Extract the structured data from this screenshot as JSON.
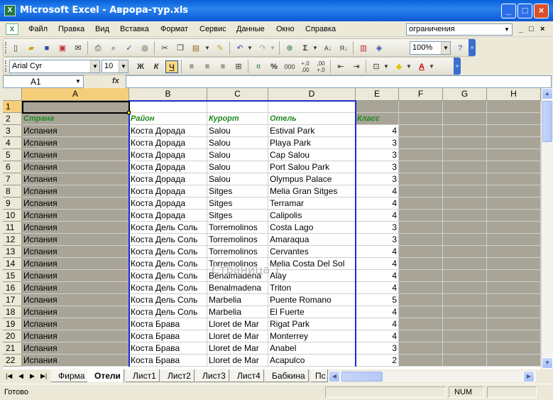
{
  "window": {
    "title": "Microsoft Excel - Аврора-тур.xls",
    "app_icon": "excel-icon",
    "controls": [
      "minimize-icon",
      "maximize-icon",
      "close-icon"
    ]
  },
  "menu": {
    "items": [
      "Файл",
      "Правка",
      "Вид",
      "Вставка",
      "Формат",
      "Сервис",
      "Данные",
      "Окно",
      "Справка"
    ],
    "help_box_value": "ограничения",
    "mdi_controls": [
      "_",
      "□",
      "×"
    ]
  },
  "toolbar_standard": {
    "zoom": "100%"
  },
  "toolbar_format": {
    "font_name": "Arial Cyr",
    "font_size": "10",
    "bold": "Ж",
    "italic": "К",
    "underline": "Ч",
    "percent": "%",
    "thousands": "000",
    "inc_decimal": "+,0\n,00",
    "dec_decimal": ",00\n+,0"
  },
  "formula_bar": {
    "name_box": "A1",
    "fx_label": "fx",
    "formula": ""
  },
  "grid": {
    "columns": [
      "A",
      "B",
      "C",
      "D",
      "E",
      "F",
      "G",
      "H"
    ],
    "selected_column": "A",
    "selected_row": "1",
    "header_row": [
      "Страна",
      "Район",
      "Курорт",
      "Отель",
      "Класс"
    ],
    "rows": [
      {
        "n": "3",
        "c": [
          "Испания",
          "Коста Дорада",
          "Salou",
          "Estival Park",
          "4"
        ]
      },
      {
        "n": "4",
        "c": [
          "Испания",
          "Коста Дорада",
          "Salou",
          "Playa Park",
          "3"
        ]
      },
      {
        "n": "5",
        "c": [
          "Испания",
          "Коста Дорада",
          "Salou",
          "Cap Salou",
          "3"
        ]
      },
      {
        "n": "6",
        "c": [
          "Испания",
          "Коста Дорада",
          "Salou",
          "Port Salou Park",
          "3"
        ]
      },
      {
        "n": "7",
        "c": [
          "Испания",
          "Коста Дорада",
          "Salou",
          "Olympus Palace",
          "3"
        ]
      },
      {
        "n": "8",
        "c": [
          "Испания",
          "Коста Дорада",
          "Sitges",
          "Melia Gran Sitges",
          "4"
        ]
      },
      {
        "n": "9",
        "c": [
          "Испания",
          "Коста Дорада",
          "Sitges",
          "Terramar",
          "4"
        ]
      },
      {
        "n": "10",
        "c": [
          "Испания",
          "Коста Дорада",
          "Sitges",
          "Calipolis",
          "4"
        ]
      },
      {
        "n": "11",
        "c": [
          "Испания",
          "Коста Дель Соль",
          "Torremolinos",
          "Costa Lago",
          "3"
        ]
      },
      {
        "n": "12",
        "c": [
          "Испания",
          "Коста Дель Соль",
          "Torremolinos",
          "Amaraqua",
          "3"
        ]
      },
      {
        "n": "13",
        "c": [
          "Испания",
          "Коста Дель Соль",
          "Torremolinos",
          "Cervantes",
          "4"
        ]
      },
      {
        "n": "14",
        "c": [
          "Испания",
          "Коста Дель Соль",
          "Torremolinos",
          "Melia Costa Del Sol",
          "4"
        ]
      },
      {
        "n": "15",
        "c": [
          "Испания",
          "Коста Дель Соль",
          "Benalmadena",
          "Alay",
          "4"
        ]
      },
      {
        "n": "16",
        "c": [
          "Испания",
          "Коста Дель Соль",
          "Benalmadena",
          "Triton",
          "4"
        ]
      },
      {
        "n": "17",
        "c": [
          "Испания",
          "Коста Дель Соль",
          "Marbelia",
          "Puente Romano",
          "5"
        ]
      },
      {
        "n": "18",
        "c": [
          "Испания",
          "Коста Дель Соль",
          "Marbelia",
          "El Fuerte",
          "4"
        ]
      },
      {
        "n": "19",
        "c": [
          "Испания",
          "Коста Брава",
          "Lloret de Mar",
          "Rigat Park",
          "4"
        ]
      },
      {
        "n": "20",
        "c": [
          "Испания",
          "Коста Брава",
          "Lloret de Mar",
          "Monterrey",
          "4"
        ]
      },
      {
        "n": "21",
        "c": [
          "Испания",
          "Коста Брава",
          "Lloret de Mar",
          "Anabel",
          "3"
        ]
      },
      {
        "n": "22",
        "c": [
          "Испания",
          "Коста Брава",
          "Lloret de Mar",
          "Acapulco",
          "2"
        ]
      }
    ],
    "watermark": "Страница 1",
    "colors": {
      "header_text": "#1f8a1f",
      "grey_fill": "#a8a497",
      "page_break": "#1d2bd4"
    }
  },
  "sheet_tabs": {
    "tabs": [
      "Фирма",
      "Отели",
      "Лист1",
      "Лист2",
      "Лист3",
      "Лист4",
      "Бабкина",
      "Пс"
    ],
    "active": "Отели"
  },
  "status": {
    "ready": "Готово",
    "num": "NUM"
  }
}
